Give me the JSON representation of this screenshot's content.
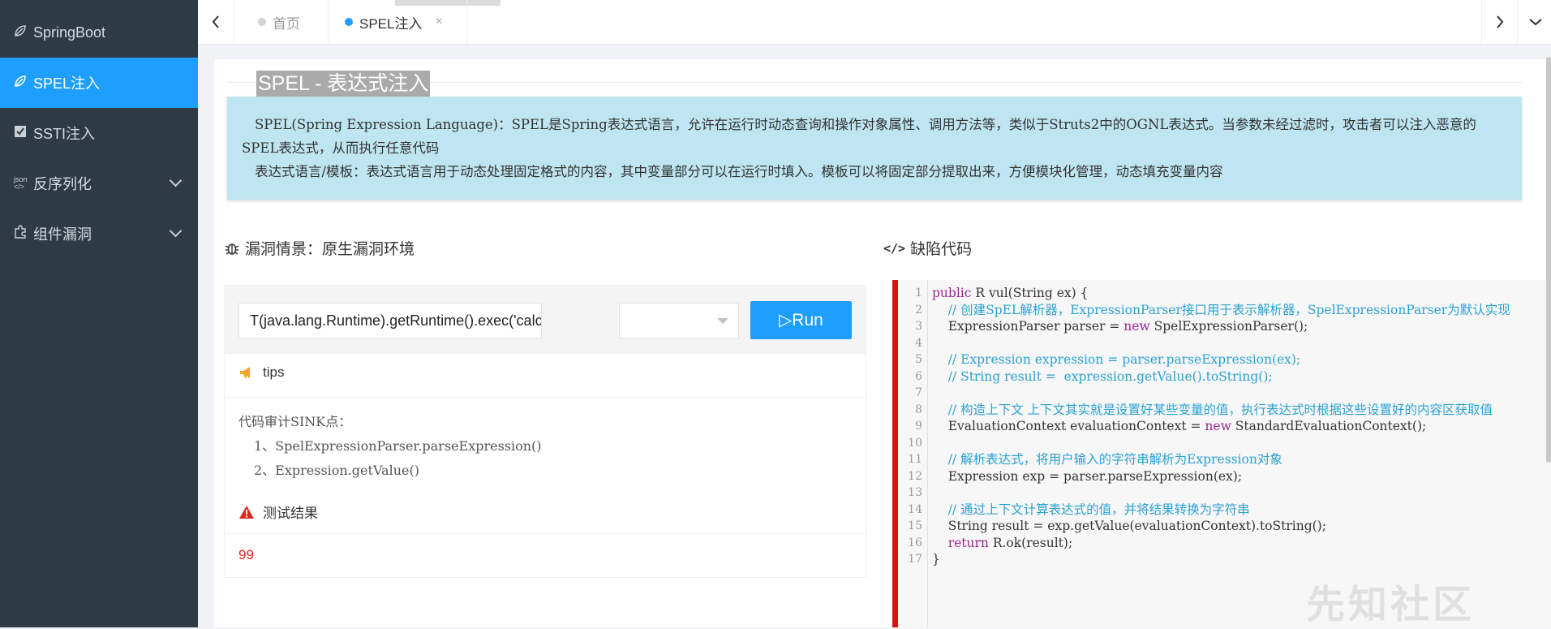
{
  "sidebar": {
    "items": [
      {
        "label": "SpringBoot",
        "icon": "leaf-icon"
      },
      {
        "label": "SPEL注入",
        "icon": "leaf-icon",
        "active": true
      },
      {
        "label": "SSTI注入",
        "icon": "checkbox-icon"
      },
      {
        "label": "反序列化",
        "icon": "json-icon"
      },
      {
        "label": "组件漏洞",
        "icon": "puzzle-icon"
      }
    ]
  },
  "tabs": [
    {
      "label": "首页",
      "active": false
    },
    {
      "label": "SPEL注入",
      "active": true,
      "close": "×"
    }
  ],
  "page": {
    "title": "SPEL - 表达式注入",
    "info_line1": "SPEL(Spring Expression Language)：SPEL是Spring表达式语言，允许在运行时动态查询和操作对象属性、调用方法等，类似于Struts2中的OGNL表达式。当参数未经过滤时，攻击者可以注入恶意的SPEL表达式，从而执行任意代码",
    "info_line2": "表达式语言/模板：表达式语言用于动态处理固定格式的内容，其中变量部分可以在运行时填入。模板可以将固定部分提取出来，方便模块化管理，动态填充变量内容"
  },
  "vuln": {
    "heading": "漏洞情景：原生漏洞环境",
    "payload": "T(java.lang.Runtime).getRuntime().exec('calc.exe')",
    "select_value": "",
    "run_label": "▷Run",
    "tips_label": "tips",
    "sink_title": "代码审计SINK点：",
    "sink_1": "1、SpelExpressionParser.parseExpression()",
    "sink_2": "2、Expression.getValue()",
    "result_label": "测试结果",
    "result_value": "99"
  },
  "code": {
    "heading": "缺陷代码",
    "lines": [
      "public R vul(String ex) {",
      "    // 创建SpEL解析器，ExpressionParser接口用于表示解析器，SpelExpressionParser为默认实现",
      "    ExpressionParser parser = new SpelExpressionParser();",
      "",
      "    // Expression expression = parser.parseExpression(ex);",
      "    // String result =  expression.getValue().toString();",
      "",
      "    // 构造上下文 上下文其实就是设置好某些变量的值，执行表达式时根据这些设置好的内容区获取值",
      "    EvaluationContext evaluationContext = new StandardEvaluationContext();",
      "",
      "    // 解析表达式，将用户输入的字符串解析为Expression对象",
      "    Expression exp = parser.parseExpression(ex);",
      "",
      "    // 通过上下文计算表达式的值，并将结果转换为字符串",
      "    String result = exp.getValue(evaluationContext).toString();",
      "    return R.ok(result);",
      "}"
    ]
  },
  "watermark": "先知社区",
  "colors": {
    "accent": "#1e9fff",
    "sidebar": "#2e3a46",
    "danger": "#dd1111",
    "info_bg": "#bee5f1"
  }
}
